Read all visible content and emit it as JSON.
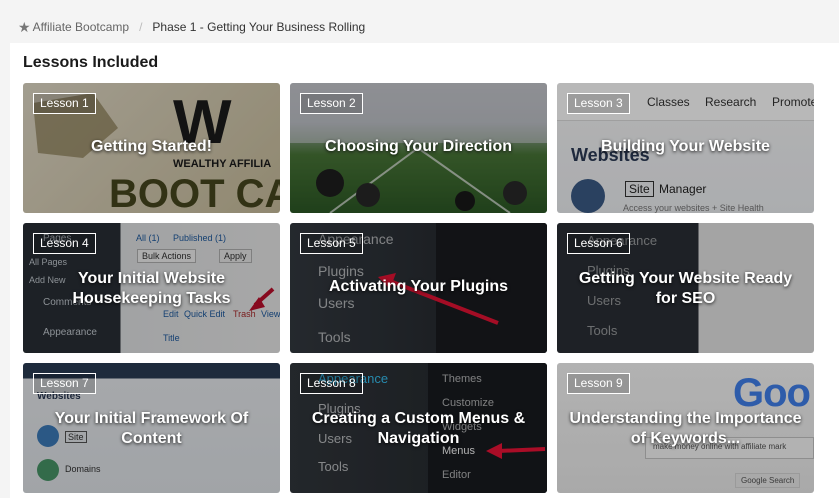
{
  "breadcrumb": {
    "root": "Affiliate Bootcamp",
    "separator": "/",
    "current": "Phase 1 - Getting Your Business Rolling"
  },
  "section": {
    "title": "Lessons Included"
  },
  "lessons": [
    {
      "badge": "Lesson 1",
      "title": "Getting Started!"
    },
    {
      "badge": "Lesson 2",
      "title": "Choosing Your Direction"
    },
    {
      "badge": "Lesson 3",
      "title": "Building Your Website"
    },
    {
      "badge": "Lesson 4",
      "title": "Your Initial Website Housekeeping Tasks"
    },
    {
      "badge": "Lesson 5",
      "title": "Activating Your Plugins"
    },
    {
      "badge": "Lesson 6",
      "title": "Getting Your Website Ready for SEO"
    },
    {
      "badge": "Lesson 7",
      "title": "Your Initial Framework Of Content"
    },
    {
      "badge": "Lesson 8",
      "title": "Creating a Custom Menus & Navigation"
    },
    {
      "badge": "Lesson 9",
      "title": "Understanding the Importance of Keywords..."
    }
  ],
  "thumbnails": {
    "l1": {
      "brand": "WEALTHY AFFILIA",
      "word": "BOOT CA"
    },
    "l3": {
      "nav": [
        "Classes",
        "Research",
        "Promote"
      ],
      "heading": "Websites",
      "site": "Site",
      "manager": "Manager",
      "sub": "Access your websites + Site Health"
    },
    "l4": {
      "items": [
        "Pages",
        "All Pages",
        "Add New",
        "Comments",
        "Appearance"
      ],
      "all": "All (1)",
      "published": "Published (1)",
      "bulk": "Bulk Actions",
      "apply": "Apply",
      "edit": "Edit",
      "quick_edit": "Quick Edit",
      "trash": "Trash",
      "view": "View",
      "col_title": "Title"
    },
    "l5": {
      "items": [
        "Appearance",
        "Plugins",
        "Users",
        "Tools"
      ]
    },
    "l6": {
      "items": [
        "Appearance",
        "Plugins",
        "Users",
        "Tools"
      ]
    },
    "l7": {
      "heading": "Websites",
      "domains": "Domains",
      "site": "Site"
    },
    "l8": {
      "items": [
        "Appearance",
        "Plugins",
        "Users",
        "Tools"
      ],
      "submenu": [
        "Themes",
        "Customize",
        "Widgets",
        "Menus",
        "Editor"
      ]
    },
    "l9": {
      "logo": "Goo",
      "search": "make money online with affiliate mark",
      "button": "Google Search"
    }
  },
  "colors": {
    "accent_arrow": "#c8102e",
    "panel": "#ffffff",
    "page_bg": "#f4f4f4"
  }
}
